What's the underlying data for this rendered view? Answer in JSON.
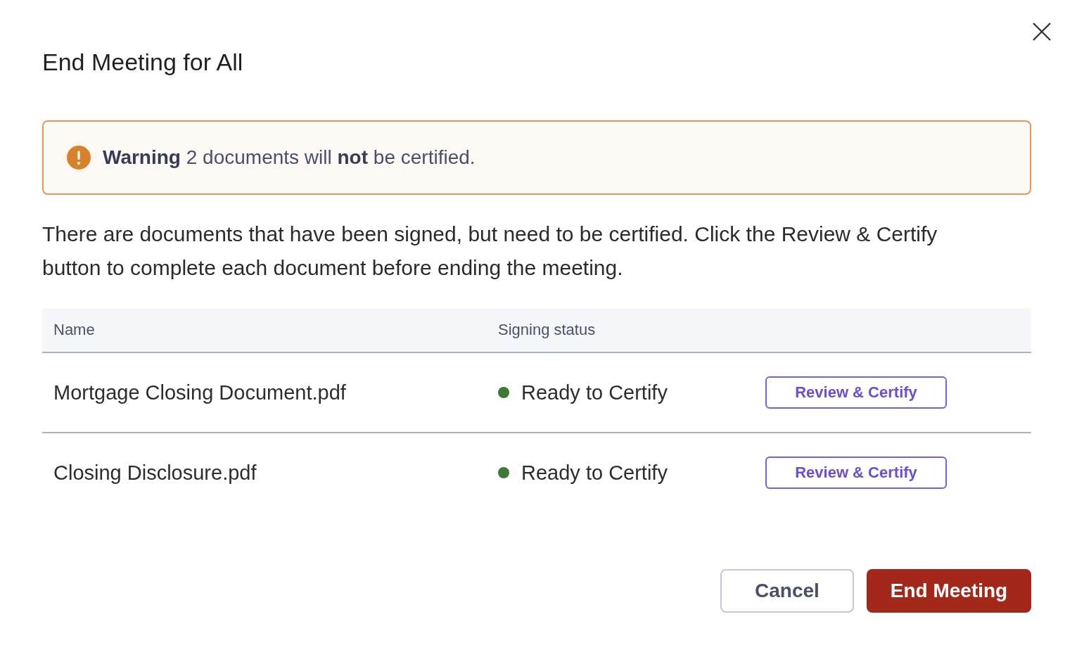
{
  "dialog": {
    "title": "End Meeting for All",
    "warning": "**Warning** 2 documents will **not** be certified.",
    "message": "There are documents that have been signed, but need to be certified. Click the Review & Certify button to complete each document before ending the meeting.",
    "table": {
      "columns": [
        "Name",
        "Signing status"
      ],
      "rows": [
        {
          "name": "Mortgage Closing Document.pdf",
          "status": "Ready to Certify",
          "color": "#3e7a36",
          "action": "Review & Certify"
        },
        {
          "name": "Closing Disclosure.pdf",
          "status": "Ready to Certify",
          "color": "#3e7a36",
          "action": "Review & Certify"
        }
      ]
    },
    "buttons": [
      {
        "label": "Cancel",
        "kind": "secondary"
      },
      {
        "label": "End Meeting",
        "kind": "primary"
      }
    ]
  }
}
